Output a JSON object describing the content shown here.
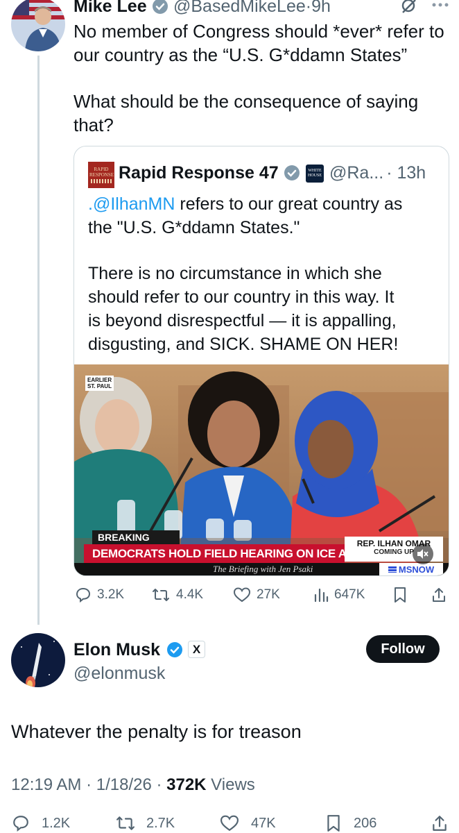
{
  "parent_tweet": {
    "author_name": "Mike Lee",
    "handle": "@BasedMikeLee",
    "separator": "·",
    "time": "9h",
    "text_line1": "No member of Congress should *ever* refer to",
    "text_line2": "our country as the “U.S. G*ddamn States”",
    "text_line3": "What should be the consequence of saying",
    "text_line4": "that?",
    "stats": {
      "replies": "3.2K",
      "reposts": "4.4K",
      "likes": "27K",
      "views": "647K"
    }
  },
  "quoted_tweet": {
    "author_name": "Rapid Response 47",
    "handle": "@Ra...",
    "time": "· 13h",
    "logo_text": "RAPID RESPONSE",
    "affiliate_badge_text": "WHITE HOUSE",
    "text_mention": ".@IlhanMN",
    "text_line1_rest": " refers to our great country as",
    "text_line2": "the \"U.S. G*ddamn States.\"",
    "text_line3": "There is no circumstance in which she",
    "text_line4": "should refer to our country in this way. It",
    "text_line5": "is beyond disrespectful — it is appalling,",
    "text_line6": "disgusting, and SICK. SHAME ON HER!",
    "video": {
      "corner_tag_line1": "EARLIER",
      "corner_tag_line2": "ST. PAUL",
      "breaking_label": "BREAKING NEWS",
      "headline": "DEMOCRATS HOLD FIELD HEARING ON ICE ABUSES",
      "lower_name": "REP. ILHAN OMAR",
      "lower_sub": "COMING UP",
      "program": "The Briefing with Jen Psaki",
      "network": "MSNOW"
    }
  },
  "reply_tweet": {
    "author_name": "Elon Musk",
    "handle": "@elonmusk",
    "affiliate_badge": "X",
    "follow_label": "Follow",
    "text": "Whatever the penalty is for treason",
    "timestamp": "12:19 AM · 1/18/26 · ",
    "views_count": "372K",
    "views_label": " Views",
    "stats": {
      "replies": "1.2K",
      "reposts": "2.7K",
      "likes": "47K",
      "bookmarks": "206"
    }
  },
  "colors": {
    "accent_blue": "#1d9bf0",
    "text": "#0f1419",
    "muted": "#536471",
    "breaking_red": "#c8102e",
    "hijab_blue": "#2d57c4"
  },
  "icons": [
    "verified-badge-icon",
    "grok-icon",
    "more-icon",
    "reply-icon",
    "repost-icon",
    "like-icon",
    "views-icon",
    "bookmark-icon",
    "share-icon",
    "mute-icon"
  ]
}
